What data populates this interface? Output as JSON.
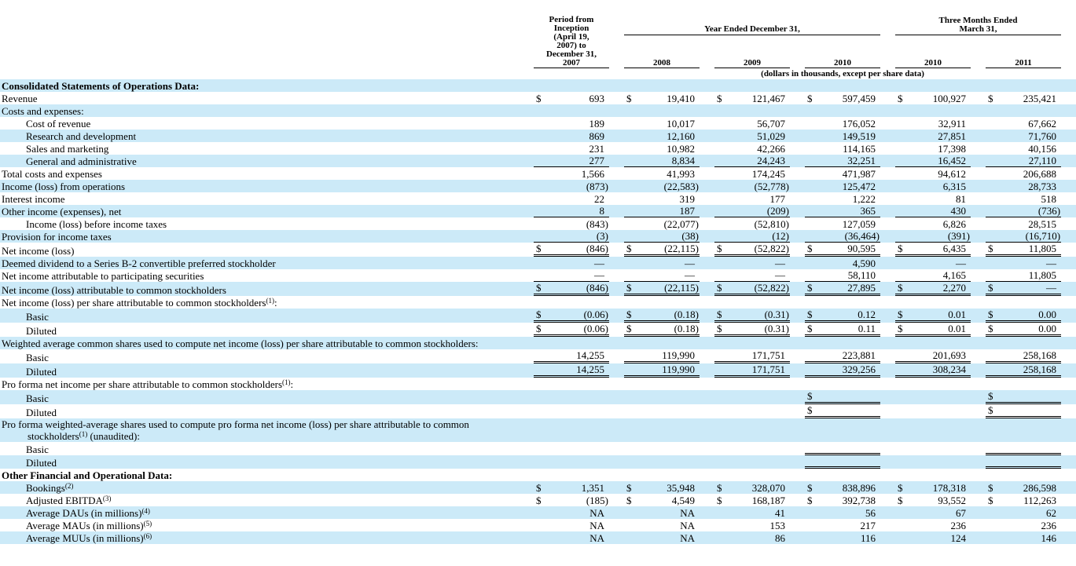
{
  "colors": {
    "row_stripe": "#cceaf8",
    "rule": "#000000",
    "background": "#ffffff"
  },
  "table": {
    "header": {
      "period_col_lines": [
        "Period from",
        "Inception",
        "(April 19,",
        "2007) to",
        "December 31,",
        "2007"
      ],
      "year_group": "Year Ended December 31,",
      "quarter_group_line1": "Three Months Ended",
      "quarter_group_line2": "March 31,",
      "year_labels": [
        "2008",
        "2009",
        "2010"
      ],
      "quarter_labels": [
        "2010",
        "2011"
      ],
      "units_note": "(dollars in thousands, except per share data)"
    },
    "rows": [
      {
        "label": "Consolidated Statements of Operations Data:",
        "bold": true,
        "indent": 0,
        "cells": null
      },
      {
        "label": "Revenue",
        "indent": 0,
        "cells": [
          [
            "$",
            "693",
            0
          ],
          [
            "$",
            "19,410",
            0
          ],
          [
            "$",
            "121,467",
            0
          ],
          [
            "$",
            "597,459",
            0
          ],
          [
            "$",
            "100,927",
            0
          ],
          [
            "$",
            "235,421",
            0
          ]
        ]
      },
      {
        "label": "Costs and expenses:",
        "indent": 0,
        "cells": null
      },
      {
        "label": "Cost of revenue",
        "indent": 1,
        "cells": [
          [
            "",
            "189",
            0
          ],
          [
            "",
            "10,017",
            0
          ],
          [
            "",
            "56,707",
            0
          ],
          [
            "",
            "176,052",
            0
          ],
          [
            "",
            "32,911",
            0
          ],
          [
            "",
            "67,662",
            0
          ]
        ]
      },
      {
        "label": "Research and development",
        "indent": 1,
        "cells": [
          [
            "",
            "869",
            0
          ],
          [
            "",
            "12,160",
            0
          ],
          [
            "",
            "51,029",
            0
          ],
          [
            "",
            "149,519",
            0
          ],
          [
            "",
            "27,851",
            0
          ],
          [
            "",
            "71,760",
            0
          ]
        ]
      },
      {
        "label": "Sales and marketing",
        "indent": 1,
        "cells": [
          [
            "",
            "231",
            0
          ],
          [
            "",
            "10,982",
            0
          ],
          [
            "",
            "42,266",
            0
          ],
          [
            "",
            "114,165",
            0
          ],
          [
            "",
            "17,398",
            0
          ],
          [
            "",
            "40,156",
            0
          ]
        ]
      },
      {
        "label": "General and administrative",
        "indent": 1,
        "cells": [
          [
            "",
            "277",
            1
          ],
          [
            "",
            "8,834",
            1
          ],
          [
            "",
            "24,243",
            1
          ],
          [
            "",
            "32,251",
            1
          ],
          [
            "",
            "16,452",
            1
          ],
          [
            "",
            "27,110",
            1
          ]
        ]
      },
      {
        "label": "Total costs and expenses",
        "indent": 0,
        "cells": [
          [
            "",
            "1,566",
            0
          ],
          [
            "",
            "41,993",
            0
          ],
          [
            "",
            "174,245",
            0
          ],
          [
            "",
            "471,987",
            0
          ],
          [
            "",
            "94,612",
            0
          ],
          [
            "",
            "206,688",
            0
          ]
        ]
      },
      {
        "label": "Income (loss) from operations",
        "indent": 0,
        "cells": [
          [
            "",
            "(873)",
            0
          ],
          [
            "",
            "(22,583)",
            0
          ],
          [
            "",
            "(52,778)",
            0
          ],
          [
            "",
            "125,472",
            0
          ],
          [
            "",
            "6,315",
            0
          ],
          [
            "",
            "28,733",
            0
          ]
        ]
      },
      {
        "label": "Interest income",
        "indent": 0,
        "cells": [
          [
            "",
            "22",
            0
          ],
          [
            "",
            "319",
            0
          ],
          [
            "",
            "177",
            0
          ],
          [
            "",
            "1,222",
            0
          ],
          [
            "",
            "81",
            0
          ],
          [
            "",
            "518",
            0
          ]
        ]
      },
      {
        "label": "Other income (expenses), net",
        "indent": 0,
        "cells": [
          [
            "",
            "8",
            1
          ],
          [
            "",
            "187",
            1
          ],
          [
            "",
            "(209)",
            1
          ],
          [
            "",
            "365",
            1
          ],
          [
            "",
            "430",
            1
          ],
          [
            "",
            "(736)",
            1
          ]
        ]
      },
      {
        "label": "Income (loss) before income taxes",
        "indent": 1,
        "cells": [
          [
            "",
            "(843)",
            0
          ],
          [
            "",
            "(22,077)",
            0
          ],
          [
            "",
            "(52,810)",
            0
          ],
          [
            "",
            "127,059",
            0
          ],
          [
            "",
            "6,826",
            0
          ],
          [
            "",
            "28,515",
            0
          ]
        ]
      },
      {
        "label": "Provision for income taxes",
        "indent": 0,
        "cells": [
          [
            "",
            "(3)",
            1
          ],
          [
            "",
            "(38)",
            1
          ],
          [
            "",
            "(12)",
            1
          ],
          [
            "",
            "(36,464)",
            1
          ],
          [
            "",
            "(391)",
            1
          ],
          [
            "",
            "(16,710)",
            1
          ]
        ]
      },
      {
        "label": "Net income (loss)",
        "indent": 0,
        "cells": [
          [
            "$",
            "(846)",
            2
          ],
          [
            "$",
            "(22,115)",
            2
          ],
          [
            "$",
            "(52,822)",
            2
          ],
          [
            "$",
            "90,595",
            2
          ],
          [
            "$",
            "6,435",
            2
          ],
          [
            "$",
            "11,805",
            2
          ]
        ]
      },
      {
        "label": "Deemed dividend to a Series B-2 convertible preferred stockholder",
        "indent": 0,
        "cells": [
          [
            "",
            "—",
            0
          ],
          [
            "",
            "—",
            0
          ],
          [
            "",
            "—",
            0
          ],
          [
            "",
            "4,590",
            0
          ],
          [
            "",
            "—",
            0
          ],
          [
            "",
            "—",
            0
          ]
        ]
      },
      {
        "label": "Net income attributable to participating securities",
        "indent": 0,
        "cells": [
          [
            "",
            "—",
            1
          ],
          [
            "",
            "—",
            1
          ],
          [
            "",
            "—",
            1
          ],
          [
            "",
            "58,110",
            1
          ],
          [
            "",
            "4,165",
            1
          ],
          [
            "",
            "11,805",
            1
          ]
        ]
      },
      {
        "label": "Net income (loss) attributable to common stockholders",
        "indent": 0,
        "cells": [
          [
            "$",
            "(846)",
            2
          ],
          [
            "$",
            "(22,115)",
            2
          ],
          [
            "$",
            "(52,822)",
            2
          ],
          [
            "$",
            "27,895",
            2
          ],
          [
            "$",
            "2,270",
            2
          ],
          [
            "$",
            "—",
            2
          ]
        ]
      },
      {
        "label": "Net income (loss) per share attributable to common stockholders",
        "sup": "(1)",
        "post": ":",
        "indent": 0,
        "cells": null
      },
      {
        "label": "Basic",
        "indent": 1,
        "cells": [
          [
            "$",
            "(0.06)",
            2
          ],
          [
            "$",
            "(0.18)",
            2
          ],
          [
            "$",
            "(0.31)",
            2
          ],
          [
            "$",
            "0.12",
            2
          ],
          [
            "$",
            "0.01",
            2
          ],
          [
            "$",
            "0.00",
            2
          ]
        ]
      },
      {
        "label": "Diluted",
        "indent": 1,
        "cells": [
          [
            "$",
            "(0.06)",
            2
          ],
          [
            "$",
            "(0.18)",
            2
          ],
          [
            "$",
            "(0.31)",
            2
          ],
          [
            "$",
            "0.11",
            2
          ],
          [
            "$",
            "0.01",
            2
          ],
          [
            "$",
            "0.00",
            2
          ]
        ]
      },
      {
        "label": "Weighted average common shares used to compute net income (loss) per share attributable to common stockholders:",
        "indent": 0,
        "cells": null
      },
      {
        "label": "Basic",
        "indent": 1,
        "cells": [
          [
            "",
            "14,255",
            2
          ],
          [
            "",
            "119,990",
            2
          ],
          [
            "",
            "171,751",
            2
          ],
          [
            "",
            "223,881",
            2
          ],
          [
            "",
            "201,693",
            2
          ],
          [
            "",
            "258,168",
            2
          ]
        ]
      },
      {
        "label": "Diluted",
        "indent": 1,
        "cells": [
          [
            "",
            "14,255",
            2
          ],
          [
            "",
            "119,990",
            2
          ],
          [
            "",
            "171,751",
            2
          ],
          [
            "",
            "329,256",
            2
          ],
          [
            "",
            "308,234",
            2
          ],
          [
            "",
            "258,168",
            2
          ]
        ]
      },
      {
        "label": "Pro forma net income per share attributable to common stockholders",
        "sup": "(1)",
        "post": ":",
        "indent": 0,
        "cells": null
      },
      {
        "label": "Basic",
        "indent": 1,
        "cells": [
          [
            "",
            "",
            0
          ],
          [
            "",
            "",
            0
          ],
          [
            "",
            "",
            0
          ],
          [
            "$",
            "",
            2
          ],
          [
            "",
            "",
            0
          ],
          [
            "$",
            "",
            2
          ]
        ]
      },
      {
        "label": "Diluted",
        "indent": 1,
        "cells": [
          [
            "",
            "",
            0
          ],
          [
            "",
            "",
            0
          ],
          [
            "",
            "",
            0
          ],
          [
            "$",
            "",
            2
          ],
          [
            "",
            "",
            0
          ],
          [
            "$",
            "",
            2
          ]
        ]
      },
      {
        "label": "Pro forma weighted-average shares used to compute pro forma net income (loss) per share attributable to common stockholders",
        "sup": "(1)",
        "post": " (unaudited):",
        "indent": 0,
        "hang": true,
        "cells": null
      },
      {
        "label": "Basic",
        "indent": 1,
        "cells": [
          [
            "",
            "",
            0
          ],
          [
            "",
            "",
            0
          ],
          [
            "",
            "",
            0
          ],
          [
            "",
            "",
            2
          ],
          [
            "",
            "",
            0
          ],
          [
            "",
            "",
            2
          ]
        ]
      },
      {
        "label": "Diluted",
        "indent": 1,
        "cells": [
          [
            "",
            "",
            0
          ],
          [
            "",
            "",
            0
          ],
          [
            "",
            "",
            0
          ],
          [
            "",
            "",
            2
          ],
          [
            "",
            "",
            0
          ],
          [
            "",
            "",
            2
          ]
        ]
      },
      {
        "label": "Other Financial and Operational Data:",
        "bold": true,
        "indent": 0,
        "cells": null
      },
      {
        "label": "Bookings",
        "sup": "(2)",
        "indent": 1,
        "cells": [
          [
            "$",
            "1,351",
            0
          ],
          [
            "$",
            "35,948",
            0
          ],
          [
            "$",
            "328,070",
            0
          ],
          [
            "$",
            "838,896",
            0
          ],
          [
            "$",
            "178,318",
            0
          ],
          [
            "$",
            "286,598",
            0
          ]
        ]
      },
      {
        "label": "Adjusted EBITDA",
        "sup": "(3)",
        "indent": 1,
        "cells": [
          [
            "$",
            "(185)",
            0
          ],
          [
            "$",
            "4,549",
            0
          ],
          [
            "$",
            "168,187",
            0
          ],
          [
            "$",
            "392,738",
            0
          ],
          [
            "$",
            "93,552",
            0
          ],
          [
            "$",
            "112,263",
            0
          ]
        ]
      },
      {
        "label": "Average DAUs (in millions)",
        "sup": "(4)",
        "indent": 1,
        "cells": [
          [
            "",
            "NA",
            0
          ],
          [
            "",
            "NA",
            0
          ],
          [
            "",
            "41",
            0
          ],
          [
            "",
            "56",
            0
          ],
          [
            "",
            "67",
            0
          ],
          [
            "",
            "62",
            0
          ]
        ]
      },
      {
        "label": "Average MAUs (in millions)",
        "sup": "(5)",
        "indent": 1,
        "cells": [
          [
            "",
            "NA",
            0
          ],
          [
            "",
            "NA",
            0
          ],
          [
            "",
            "153",
            0
          ],
          [
            "",
            "217",
            0
          ],
          [
            "",
            "236",
            0
          ],
          [
            "",
            "236",
            0
          ]
        ]
      },
      {
        "label": "Average MUUs (in millions)",
        "sup": "(6)",
        "indent": 1,
        "cells": [
          [
            "",
            "NA",
            0
          ],
          [
            "",
            "NA",
            0
          ],
          [
            "",
            "86",
            0
          ],
          [
            "",
            "116",
            0
          ],
          [
            "",
            "124",
            0
          ],
          [
            "",
            "146",
            0
          ]
        ]
      }
    ]
  }
}
